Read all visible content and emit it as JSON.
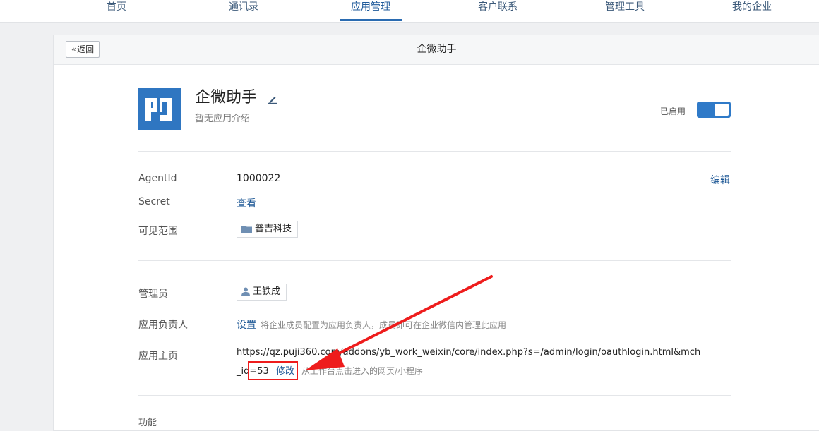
{
  "topnav": {
    "items": [
      "首页",
      "通讯录",
      "应用管理",
      "客户联系",
      "管理工具",
      "我的企业"
    ],
    "active_index": 2
  },
  "header": {
    "back_label": "返回",
    "title": "企微助手"
  },
  "app": {
    "name": "企微助手",
    "description": "暂无应用介绍",
    "status_label": "已启用",
    "enabled": true,
    "icon_color": "#2f76c1"
  },
  "details": {
    "agentid_label": "AgentId",
    "agentid_value": "1000022",
    "secret_label": "Secret",
    "secret_action": "查看",
    "scope_label": "可见范围",
    "scope_value": "普吉科技",
    "edit_label": "编辑"
  },
  "admin": {
    "admin_label": "管理员",
    "admin_value": "王铁成",
    "owner_label": "应用负责人",
    "owner_action": "设置",
    "owner_hint": "将企业成员配置为应用负责人，成员即可在企业微信内管理此应用",
    "homepage_label": "应用主页",
    "homepage_url": "https://qz.puji360.com/addons/yb_work_weixin/core/index.php?s=/admin/login/oauthlogin.html&mch_id=53",
    "homepage_action": "修改",
    "homepage_hint": "从工作台点击进入的网页/小程序"
  },
  "features": {
    "label": "功能"
  },
  "annotation": {
    "color": "#ee1c1c"
  }
}
